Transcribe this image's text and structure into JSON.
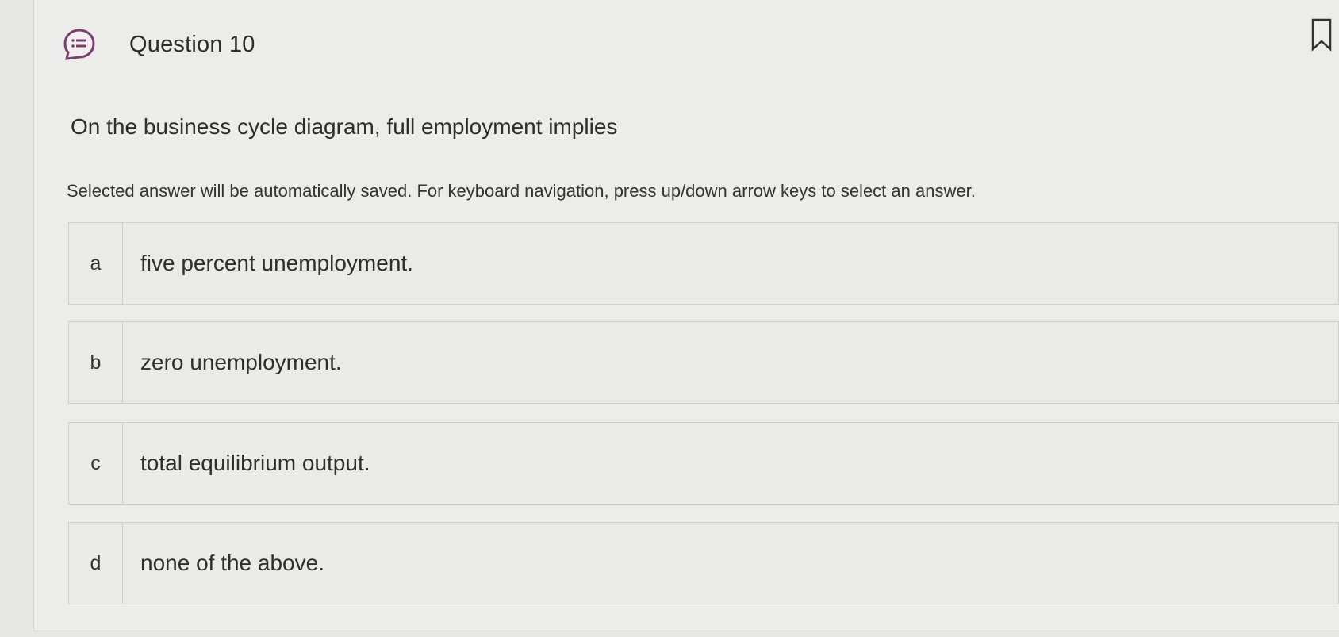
{
  "question": {
    "title": "Question 10",
    "icon": "list-chat-bubble-icon",
    "bookmark_icon": "bookmark-icon",
    "prompt": "On the business cycle diagram, full employment implies",
    "instructions": "Selected answer will be automatically saved. For keyboard navigation, press up/down arrow keys to select an answer."
  },
  "options": [
    {
      "letter": "a",
      "text": "five percent unemployment."
    },
    {
      "letter": "b",
      "text": "zero unemployment."
    },
    {
      "letter": "c",
      "text": "total equilibrium output."
    },
    {
      "letter": "d",
      "text": "none of the above."
    }
  ],
  "colors": {
    "icon_accent": "#7a3f6b",
    "border": "#cfd0ce",
    "background": "#ececea"
  }
}
